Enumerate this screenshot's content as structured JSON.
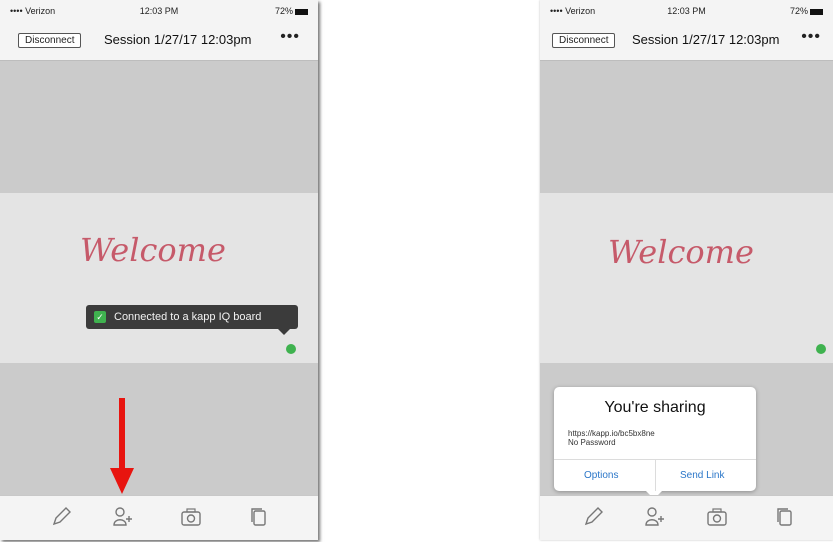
{
  "left": {
    "status": {
      "carrier": "•••• Verizon",
      "time": "12:03 PM",
      "battery": "72%"
    },
    "nav": {
      "disconnect": "Disconnect",
      "title": "Session 1/27/17 12:03pm",
      "more": "•••"
    },
    "board_text": "Welcome",
    "toast": "Connected to a kapp IQ board"
  },
  "right": {
    "status": {
      "carrier": "•••• Verizon",
      "time": "12:03 PM",
      "battery": "72%"
    },
    "nav": {
      "disconnect": "Disconnect",
      "title": "Session 1/27/17 12:03pm",
      "more": "•••"
    },
    "board_text": "Welcome",
    "share": {
      "title": "You're sharing",
      "url": "https://kapp.io/bc5bx8ne",
      "password": "No Password",
      "options": "Options",
      "send_link": "Send Link"
    }
  },
  "colors": {
    "accent_green": "#3fb24f",
    "arrow_red": "#e8140f",
    "link_blue": "#2a76c8"
  },
  "toolbar_icons": [
    "pencil-icon",
    "add-person-icon",
    "camera-icon",
    "copy-icon"
  ]
}
